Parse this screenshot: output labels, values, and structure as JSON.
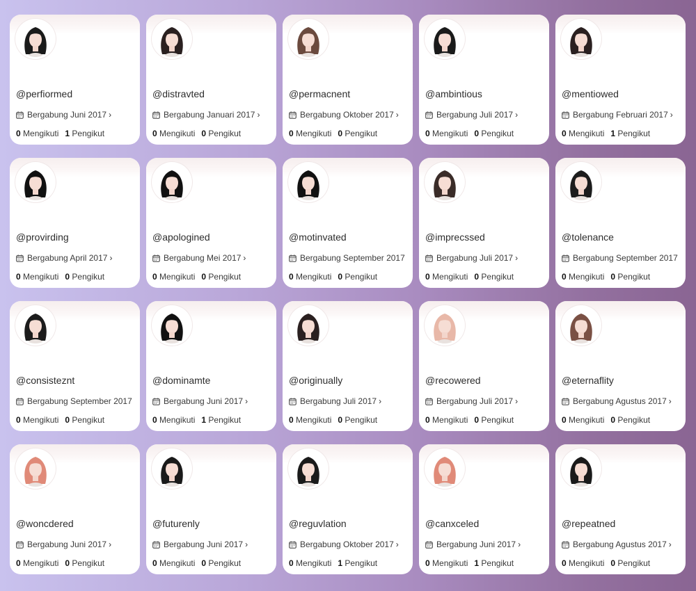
{
  "labels": {
    "following": "Mengikuti",
    "followers": "Pengikut"
  },
  "icons": {
    "calendar": "calendar-icon",
    "chevron": "chevron-right-icon"
  },
  "colors": {
    "card": "#ffffff",
    "banner": "#f6eeee",
    "bg_left": "#c9c2ee",
    "bg_right": "#8a6593"
  },
  "profiles": [
    {
      "handle": "@perfiormed",
      "joined": "Bergabung Juni 2017",
      "following": "0",
      "followers": "1",
      "hair": "#1a1a1a",
      "chevron": true
    },
    {
      "handle": "@distravted",
      "joined": "Bergabung Januari 2017",
      "following": "0",
      "followers": "0",
      "hair": "#2a2020",
      "chevron": true
    },
    {
      "handle": "@permacnent",
      "joined": "Bergabung Oktober 2017",
      "following": "0",
      "followers": "0",
      "hair": "#6b4a3e",
      "chevron": true
    },
    {
      "handle": "@ambintious",
      "joined": "Bergabung Juli 2017",
      "following": "0",
      "followers": "0",
      "hair": "#1a1a1a",
      "chevron": true
    },
    {
      "handle": "@mentiowed",
      "joined": "Bergabung Februari 2017",
      "following": "0",
      "followers": "1",
      "hair": "#2a2020",
      "chevron": true
    },
    {
      "handle": "@provirding",
      "joined": "Bergabung April 2017",
      "following": "0",
      "followers": "0",
      "hair": "#111111",
      "chevron": true
    },
    {
      "handle": "@apologined",
      "joined": "Bergabung Mei 2017",
      "following": "0",
      "followers": "0",
      "hair": "#111111",
      "chevron": true
    },
    {
      "handle": "@motinvated",
      "joined": "Bergabung September 2017",
      "following": "0",
      "followers": "0",
      "hair": "#111111",
      "chevron": false
    },
    {
      "handle": "@imprecssed",
      "joined": "Bergabung Juli 2017",
      "following": "0",
      "followers": "0",
      "hair": "#3a2c28",
      "chevron": true
    },
    {
      "handle": "@tolenance",
      "joined": "Bergabung September 2017",
      "following": "0",
      "followers": "0",
      "hair": "#1c1c1c",
      "chevron": false
    },
    {
      "handle": "@consisteznt",
      "joined": "Bergabung September 2017",
      "following": "0",
      "followers": "0",
      "hair": "#1c1c1c",
      "chevron": false
    },
    {
      "handle": "@dominamte",
      "joined": "Bergabung Juni 2017",
      "following": "0",
      "followers": "1",
      "hair": "#111111",
      "chevron": true
    },
    {
      "handle": "@originually",
      "joined": "Bergabung Juli 2017",
      "following": "0",
      "followers": "0",
      "hair": "#2a2020",
      "chevron": true
    },
    {
      "handle": "@recowered",
      "joined": "Bergabung Juli 2017",
      "following": "0",
      "followers": "0",
      "hair": "#e8b8a8",
      "chevron": true
    },
    {
      "handle": "@eternaflity",
      "joined": "Bergabung Agustus 2017",
      "following": "0",
      "followers": "0",
      "hair": "#7a5044",
      "chevron": true
    },
    {
      "handle": "@woncdered",
      "joined": "Bergabung Juni 2017",
      "following": "0",
      "followers": "0",
      "hair": "#e08a78",
      "chevron": true
    },
    {
      "handle": "@futurenly",
      "joined": "Bergabung Juni 2017",
      "following": "0",
      "followers": "0",
      "hair": "#1a1a1a",
      "chevron": true
    },
    {
      "handle": "@reguvlation",
      "joined": "Bergabung Oktober 2017",
      "following": "0",
      "followers": "1",
      "hair": "#1a1a1a",
      "chevron": true
    },
    {
      "handle": "@canxceled",
      "joined": "Bergabung Juni 2017",
      "following": "0",
      "followers": "1",
      "hair": "#e08a78",
      "chevron": true
    },
    {
      "handle": "@repeatned",
      "joined": "Bergabung Agustus 2017",
      "following": "0",
      "followers": "0",
      "hair": "#1a1a1a",
      "chevron": true
    }
  ]
}
